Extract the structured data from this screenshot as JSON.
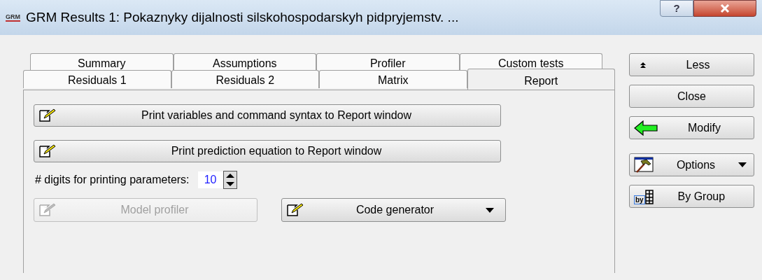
{
  "window": {
    "icon_label": "GRM",
    "title": "GRM Results 1: Pokaznyky dijalnosti silskohospodarskyh pidpryjemstv. ...",
    "help_button": "?"
  },
  "tab_rows": [
    [
      {
        "label": "Summary",
        "selected": false
      },
      {
        "label": "Assumptions",
        "selected": false
      },
      {
        "label": "Profiler",
        "selected": false
      },
      {
        "label": "Custom tests",
        "selected": false
      }
    ],
    [
      {
        "label": "Residuals 1",
        "selected": false
      },
      {
        "label": "Residuals 2",
        "selected": false
      },
      {
        "label": "Matrix",
        "selected": false
      },
      {
        "label": "Report",
        "selected": true
      }
    ]
  ],
  "panel": {
    "wide_buttons": [
      {
        "label": "Print variables and command syntax to Report window",
        "disabled": false
      },
      {
        "label": "Print prediction equation to Report window",
        "disabled": false
      }
    ],
    "digits": {
      "label": "# digits for printing parameters:",
      "value": "10"
    },
    "bottom_buttons": [
      {
        "label": "Model profiler",
        "disabled": true,
        "dropdown": false
      },
      {
        "label": "Code generator",
        "disabled": false,
        "dropdown": true
      }
    ]
  },
  "side_buttons": [
    {
      "kind": "less",
      "label": "Less"
    },
    {
      "kind": "plain",
      "label": "Close"
    },
    {
      "kind": "modify",
      "label": "Modify"
    },
    {
      "kind": "options",
      "label": "Options"
    },
    {
      "kind": "bygroup",
      "label": "By Group",
      "icon_label": "by"
    }
  ]
}
